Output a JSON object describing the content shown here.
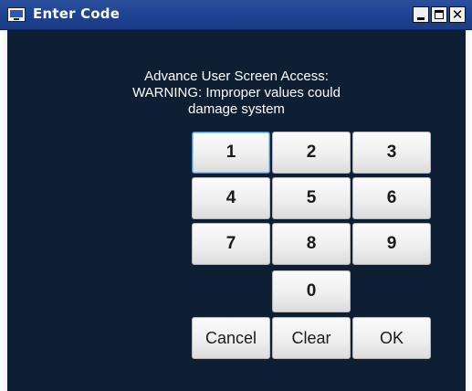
{
  "window": {
    "title": "Enter Code"
  },
  "message": {
    "line1": "Advance User Screen Access:",
    "line2": "WARNING: Improper values could",
    "line3": "damage system"
  },
  "keypad": {
    "k1": "1",
    "k2": "2",
    "k3": "3",
    "k4": "4",
    "k5": "5",
    "k6": "6",
    "k7": "7",
    "k8": "8",
    "k9": "9",
    "k0": "0",
    "cancel": "Cancel",
    "clear": "Clear",
    "ok": "OK"
  },
  "colors": {
    "title_bar": "#1f4494",
    "background": "#0f1f33",
    "button_face": "#efefef",
    "focus_ring": "#3f8ed0"
  }
}
